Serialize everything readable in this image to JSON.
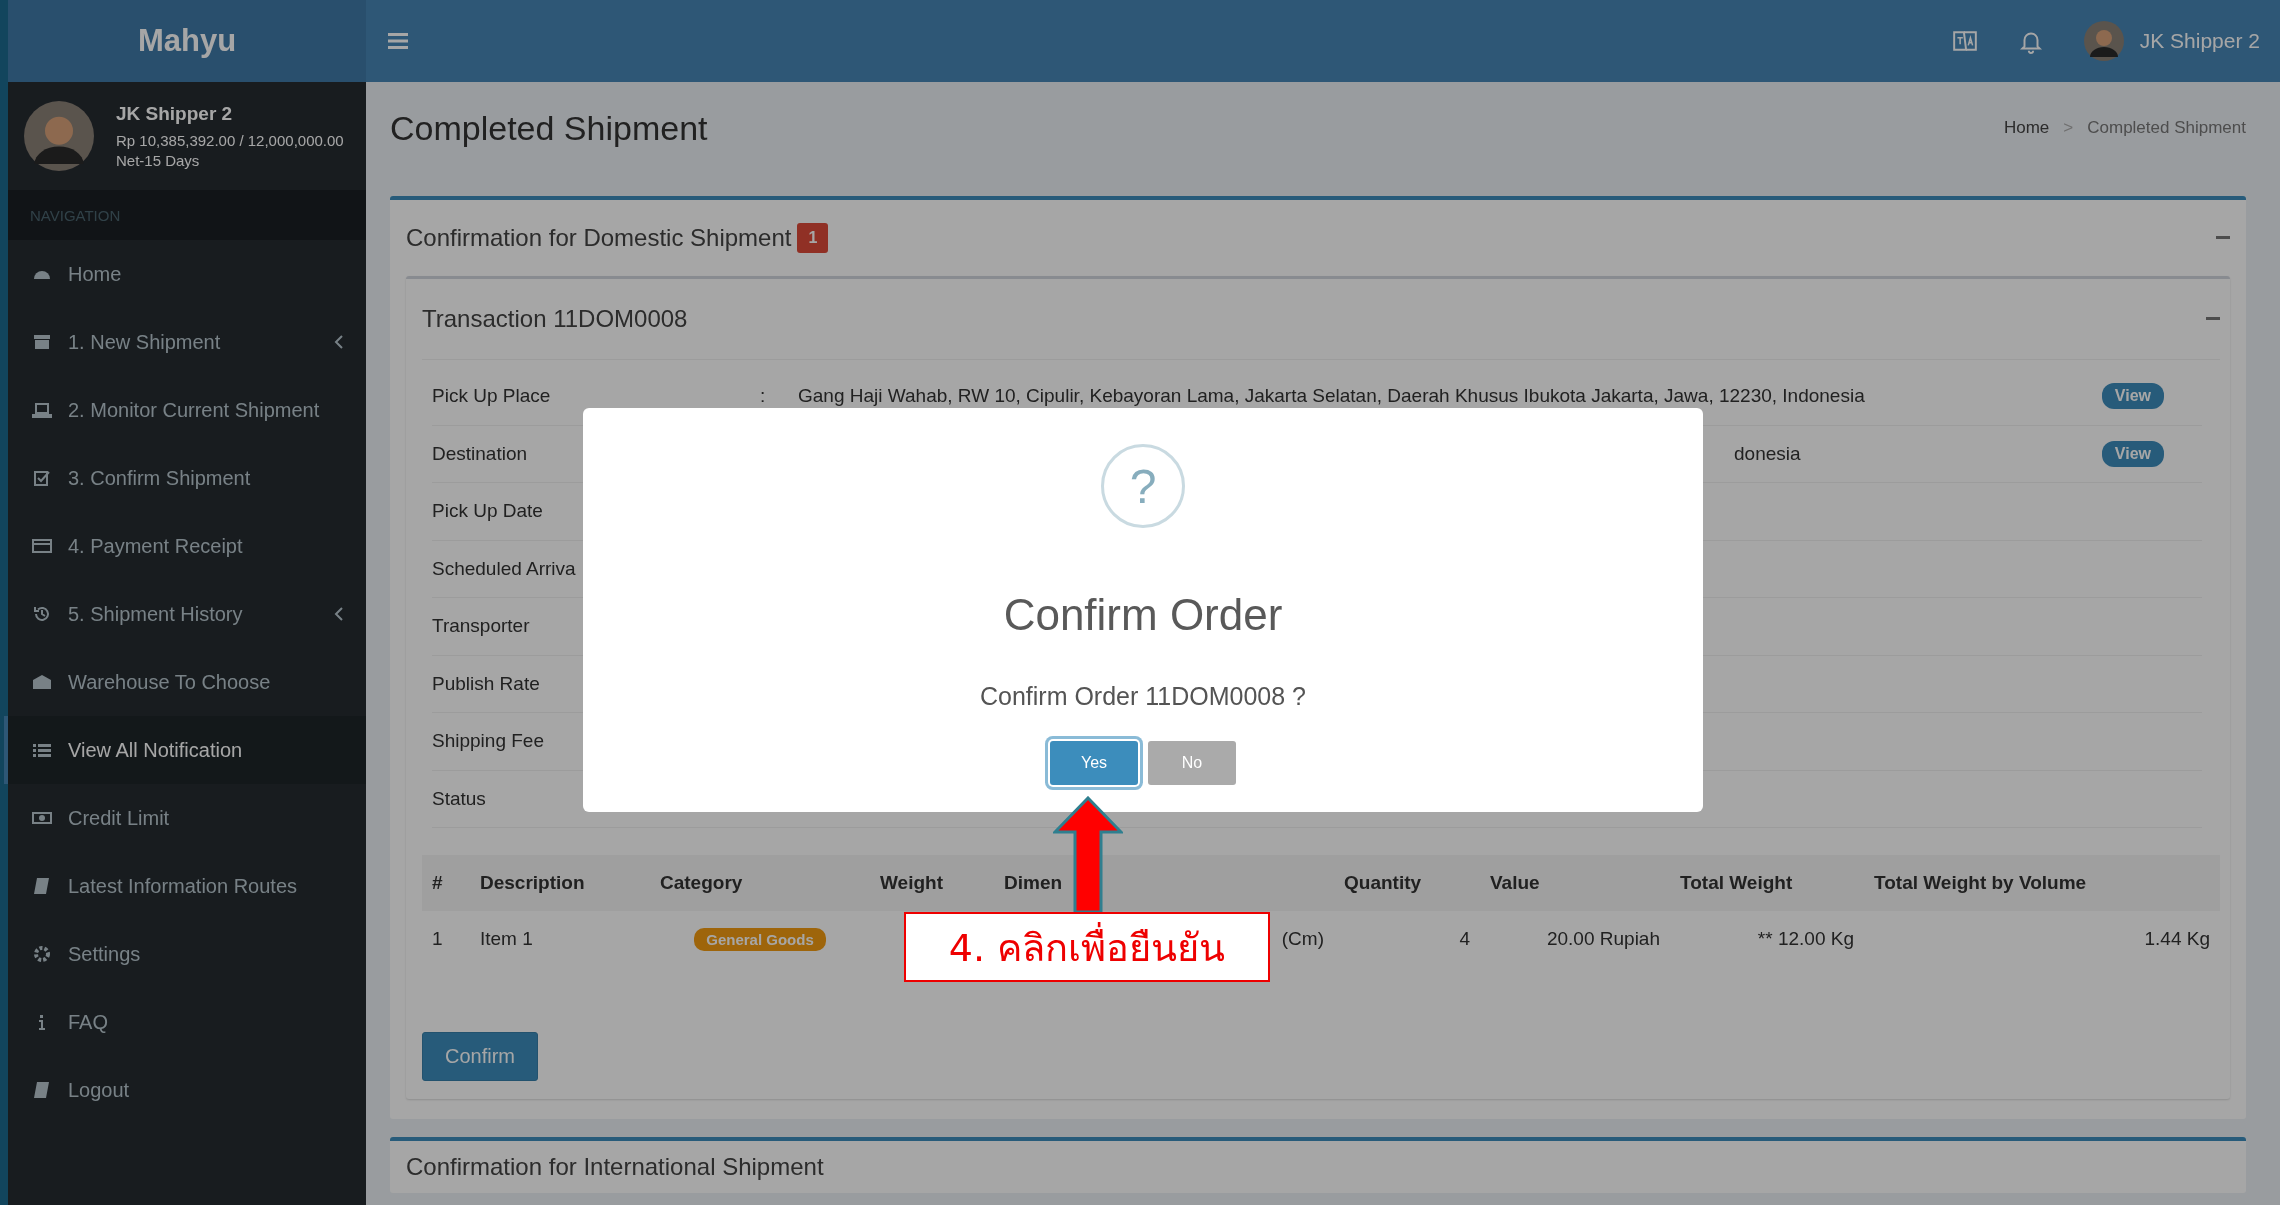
{
  "brand": "Mahyu",
  "topbar": {
    "user_name": "JK Shipper 2"
  },
  "user_panel": {
    "name": "JK Shipper 2",
    "balance": "Rp 10,385,392.00 / 12,000,000.00",
    "terms": "Net-15 Days"
  },
  "sidebar": {
    "header": "NAVIGATION",
    "items": [
      {
        "label": "Home",
        "selected": false,
        "has_submenu": false
      },
      {
        "label": "1. New Shipment",
        "selected": false,
        "has_submenu": true
      },
      {
        "label": "2. Monitor Current Shipment",
        "selected": false,
        "has_submenu": false
      },
      {
        "label": "3. Confirm Shipment",
        "selected": false,
        "has_submenu": false
      },
      {
        "label": "4. Payment Receipt",
        "selected": false,
        "has_submenu": false
      },
      {
        "label": "5. Shipment History",
        "selected": false,
        "has_submenu": true
      },
      {
        "label": "Warehouse To Choose",
        "selected": false,
        "has_submenu": false
      },
      {
        "label": "View All Notification",
        "selected": true,
        "has_submenu": false
      },
      {
        "label": "Credit Limit",
        "selected": false,
        "has_submenu": false
      },
      {
        "label": "Latest Information Routes",
        "selected": false,
        "has_submenu": false
      },
      {
        "label": "Settings",
        "selected": false,
        "has_submenu": false
      },
      {
        "label": "FAQ",
        "selected": false,
        "has_submenu": false
      },
      {
        "label": "Logout",
        "selected": false,
        "has_submenu": false
      }
    ]
  },
  "page_title": "Completed Shipment",
  "breadcrumb": {
    "items": [
      "Home",
      "Completed Shipment"
    ],
    "separator": ">"
  },
  "domestic": {
    "title": "Confirmation for Domestic Shipment",
    "badge": "1",
    "transaction": {
      "title": "Transaction 11DOM0008",
      "details": [
        {
          "label": "Pick Up Place",
          "colon": ":",
          "value": "Gang Haji Wahab, RW 10, Cipulir, Kebayoran Lama, Jakarta Selatan, Daerah Khusus Ibukota Jakarta, Jawa, 12230, Indonesia",
          "kind": "full",
          "action": "View"
        },
        {
          "label": "Destination",
          "value": "donesia",
          "kind": "partial",
          "action": "View"
        },
        {
          "label": "Pick Up Date"
        },
        {
          "label": "Scheduled Arriva"
        },
        {
          "label": "Transporter"
        },
        {
          "label": "Publish Rate"
        },
        {
          "label": "Shipping Fee"
        },
        {
          "label": "Status"
        }
      ],
      "table": {
        "columns": [
          {
            "label": "#",
            "kind": "text"
          },
          {
            "label": "Description",
            "kind": "text"
          },
          {
            "label": "Category",
            "kind": "badge"
          },
          {
            "label": "Weight",
            "kind": "text"
          },
          {
            "label": "Dimen",
            "kind": "text"
          },
          {
            "label": "Quantity",
            "kind": "text"
          },
          {
            "label": "Value",
            "kind": "text"
          },
          {
            "label": "Total Weight",
            "kind": "text"
          },
          {
            "label": "Total Weight by Volume",
            "kind": "text"
          }
        ],
        "rows": [
          {
            "cells": [
              "1",
              "Item 1",
              "General Goods",
              null,
              "(Cm)",
              "4",
              "20.00 Rupiah",
              "** 12.00 Kg",
              "1.44 Kg"
            ]
          }
        ]
      },
      "confirm_button": "Confirm"
    }
  },
  "international": {
    "title": "Confirmation for International Shipment"
  },
  "modal": {
    "icon_text": "?",
    "title": "Confirm Order",
    "message": "Confirm Order 11DOM0008 ?",
    "buttons": [
      {
        "label": "Yes",
        "kind": "primary",
        "focused": true
      },
      {
        "label": "No",
        "kind": "secondary",
        "focused": false
      }
    ]
  },
  "callout": {
    "text": "4. คลิกเพื่อยืนยัน"
  }
}
